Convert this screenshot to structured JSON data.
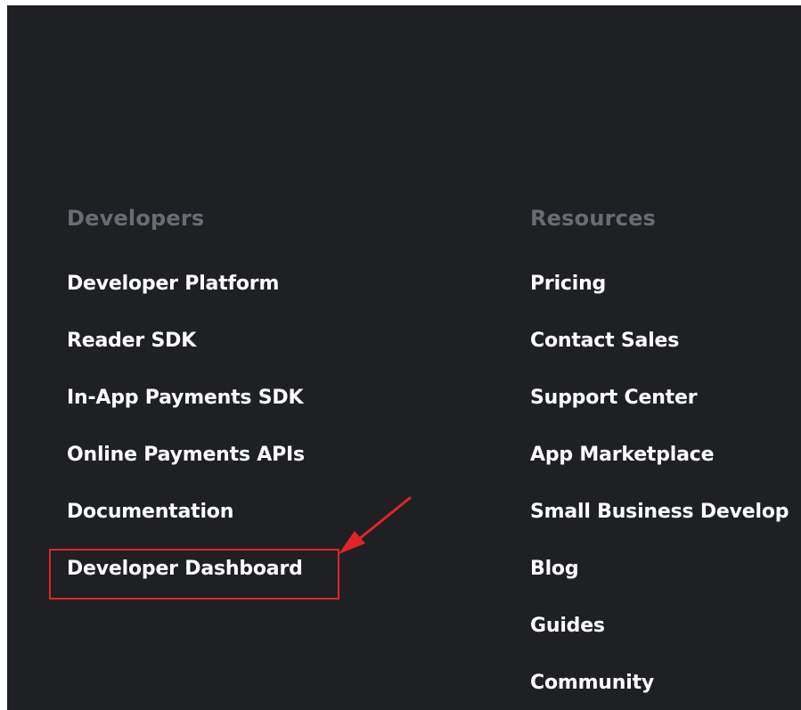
{
  "footer": {
    "developers": {
      "heading": "Developers",
      "links": [
        "Developer Platform",
        "Reader SDK",
        "In-App Payments SDK",
        "Online Payments APIs",
        "Documentation",
        "Developer Dashboard"
      ]
    },
    "resources": {
      "heading": "Resources",
      "links": [
        "Pricing",
        "Contact Sales",
        "Support Center",
        "App Marketplace",
        "Small Business Develop",
        "Blog",
        "Guides",
        "Community"
      ]
    }
  },
  "annotation": {
    "highlighted_item": "Developer Dashboard",
    "color": "#e3232a"
  },
  "colors": {
    "background": "#1f2024",
    "heading": "#6a6c72",
    "link": "#ffffff"
  }
}
